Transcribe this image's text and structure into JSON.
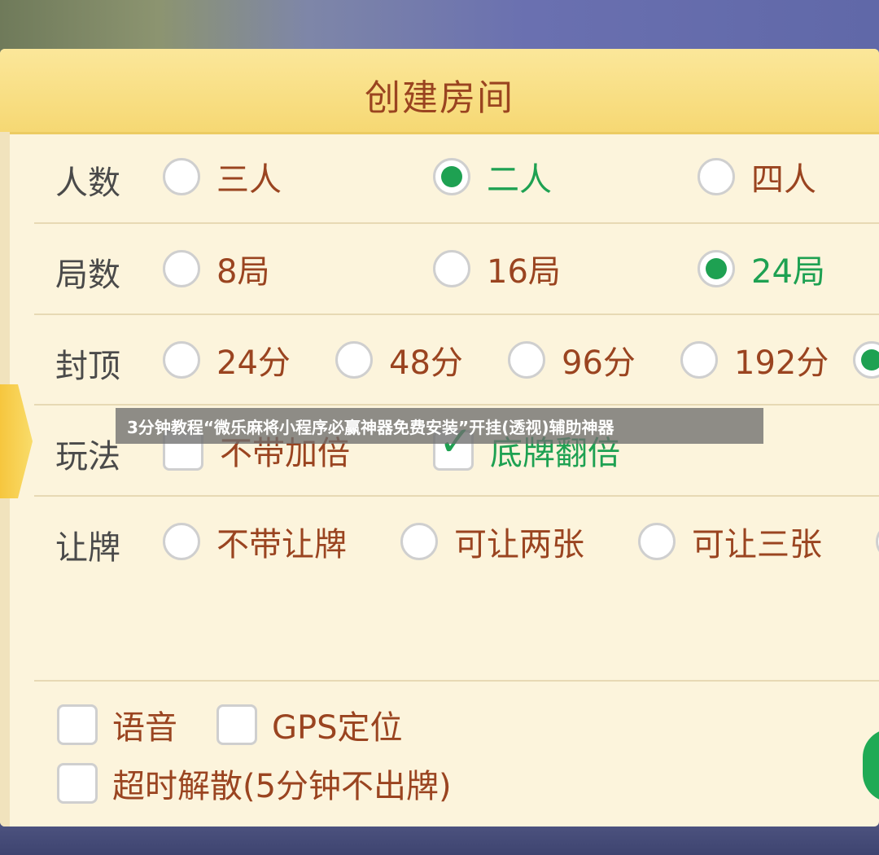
{
  "dialog": {
    "title": "创建房间"
  },
  "rows": {
    "players": {
      "label": "人数",
      "options": [
        {
          "label": "三人",
          "selected": false
        },
        {
          "label": "二人",
          "selected": true
        },
        {
          "label": "四人",
          "selected": false
        }
      ]
    },
    "rounds": {
      "label": "局数",
      "options": [
        {
          "label": "8局",
          "selected": false
        },
        {
          "label": "16局",
          "selected": false
        },
        {
          "label": "24局",
          "selected": true
        }
      ]
    },
    "cap": {
      "label": "封顶",
      "options": [
        {
          "label": "24分",
          "selected": false
        },
        {
          "label": "48分",
          "selected": false
        },
        {
          "label": "96分",
          "selected": false
        },
        {
          "label": "192分",
          "selected": false
        },
        {
          "label": "",
          "selected": true
        }
      ]
    },
    "rules": {
      "label": "玩法",
      "options": [
        {
          "label": "不带加倍",
          "checked": false
        },
        {
          "label": "底牌翻倍",
          "checked": true
        }
      ]
    },
    "yield": {
      "label": "让牌",
      "options": [
        {
          "label": "不带让牌",
          "selected": false
        },
        {
          "label": "可让两张",
          "selected": false
        },
        {
          "label": "可让三张",
          "selected": false
        }
      ]
    }
  },
  "extras": [
    {
      "label": "语音",
      "checked": false
    },
    {
      "label": "GPS定位",
      "checked": false
    },
    {
      "label": "超时解散(5分钟不出牌)",
      "checked": false
    }
  ],
  "overlay_banner": "3分钟教程“微乐麻将小程序必赢神器免费安装”开挂(透视)辅助神器",
  "colors": {
    "accent_green": "#1ea152",
    "text_brown": "#9a4420",
    "header_yellow": "#f6d873"
  }
}
